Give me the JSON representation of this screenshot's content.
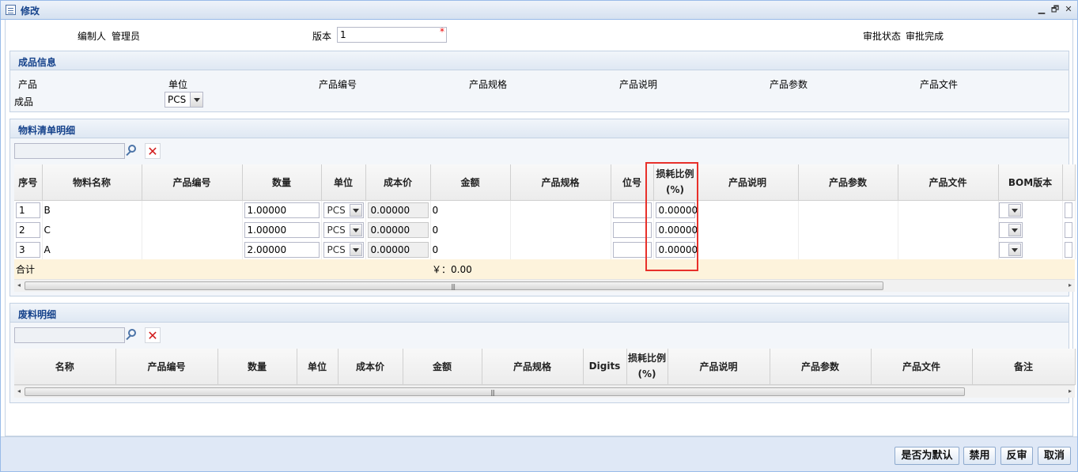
{
  "window": {
    "title": "修改",
    "minimize_symbol": "▁",
    "restore_symbol": "🗗",
    "close_symbol": "✕"
  },
  "header": {
    "editor_label": "编制人",
    "editor_value": "管理员",
    "version_label": "版本",
    "version_value": "1",
    "required_mark": "*",
    "approval_label": "审批状态",
    "approval_value": "审批完成"
  },
  "product_info": {
    "title": "成品信息",
    "columns": [
      "产品",
      "单位",
      "产品编号",
      "产品规格",
      "产品说明",
      "产品参数",
      "产品文件"
    ],
    "product_value": "成品",
    "unit_value": "PCS"
  },
  "bom": {
    "title": "物料清单明细",
    "search_placeholder": "",
    "columns": [
      "序号",
      "物料名称",
      "产品编号",
      "数量",
      "单位",
      "成本价",
      "金额",
      "产品规格",
      "位号",
      "损耗比例\n(%)",
      "产品说明",
      "产品参数",
      "产品文件",
      "BOM版本"
    ],
    "loss_header_line1": "损耗比例",
    "loss_header_line2": "(%)",
    "rows": [
      {
        "seq": "1",
        "name": "B",
        "code": "",
        "qty": "1.00000",
        "unit": "PCS",
        "cost": "0.00000",
        "amount": "0",
        "spec": "",
        "pos": "",
        "loss": "0.00000"
      },
      {
        "seq": "2",
        "name": "C",
        "code": "",
        "qty": "1.00000",
        "unit": "PCS",
        "cost": "0.00000",
        "amount": "0",
        "spec": "",
        "pos": "",
        "loss": "0.00000"
      },
      {
        "seq": "3",
        "name": "A",
        "code": "",
        "qty": "2.00000",
        "unit": "PCS",
        "cost": "0.00000",
        "amount": "0",
        "spec": "",
        "pos": "",
        "loss": "0.00000"
      }
    ],
    "total_label": "合计",
    "total_value": "￥：0.00"
  },
  "scrap": {
    "title": "废料明细",
    "columns": [
      "名称",
      "产品编号",
      "数量",
      "单位",
      "成本价",
      "金额",
      "产品规格",
      "Digits",
      "损耗比例",
      "产品说明",
      "产品参数",
      "产品文件",
      "备注"
    ],
    "loss_header_line1": "损耗比例",
    "loss_header_line2": "(%)"
  },
  "scrollbar": {
    "left_arrow": "◂",
    "right_arrow": "▸",
    "grip": "|||"
  },
  "footer": {
    "default_button": "是否为默认",
    "disable_button": "禁用",
    "unapprove_button": "反审",
    "cancel_button": "取消"
  },
  "colors": {
    "highlight": "#e8302a",
    "title_text": "#15428b",
    "delete_icon": "#d21b1b",
    "summary_row": "#fdf3dc"
  }
}
